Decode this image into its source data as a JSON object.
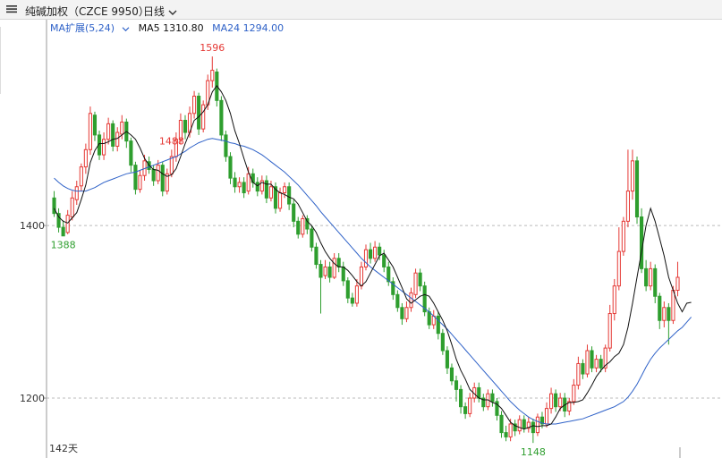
{
  "toolbar": {
    "menu_icon": "hamburger-icon",
    "symbol": "纯碱加权（CZCE 9950）",
    "period": "日线",
    "period_icon": "chevron-down-icon"
  },
  "ma_bar": {
    "ext_label": "MA扩展(5,24)",
    "ma5_label": "MA5 1310.80",
    "ma24_label": "MA24 1294.00",
    "ma5_color": "#111111",
    "ma24_color": "#2f62c8",
    "ext_color": "#2f62c8"
  },
  "colors": {
    "up": "#e53935",
    "down": "#2e9e2e",
    "grid": "#bbbbbb"
  },
  "chart_data": {
    "type": "candlestick",
    "days_label": "142天",
    "y_ticks": [
      1200,
      1400
    ],
    "ylim": [
      1143,
      1620
    ],
    "annotations": {
      "high": 1596,
      "high2": 1488,
      "low": 1148,
      "low_start": 1388
    },
    "ma5_latest": 1310.8,
    "ma24_latest": 1294.0,
    "candles": [
      [
        1432,
        1414,
        1440,
        1410
      ],
      [
        1414,
        1398,
        1420,
        1392
      ],
      [
        1398,
        1388,
        1406,
        1388
      ],
      [
        1392,
        1412,
        1418,
        1390
      ],
      [
        1410,
        1432,
        1440,
        1406
      ],
      [
        1430,
        1445,
        1452,
        1424
      ],
      [
        1446,
        1468,
        1472,
        1440
      ],
      [
        1468,
        1488,
        1495,
        1460
      ],
      [
        1488,
        1530,
        1538,
        1482
      ],
      [
        1528,
        1505,
        1532,
        1498
      ],
      [
        1505,
        1482,
        1510,
        1476
      ],
      [
        1482,
        1500,
        1508,
        1476
      ],
      [
        1500,
        1518,
        1525,
        1494
      ],
      [
        1518,
        1492,
        1522,
        1486
      ],
      [
        1492,
        1508,
        1514,
        1486
      ],
      [
        1506,
        1520,
        1528,
        1500
      ],
      [
        1520,
        1498,
        1524,
        1490
      ],
      [
        1498,
        1470,
        1502,
        1462
      ],
      [
        1470,
        1442,
        1474,
        1436
      ],
      [
        1442,
        1458,
        1464,
        1438
      ],
      [
        1458,
        1475,
        1482,
        1452
      ],
      [
        1474,
        1465,
        1480,
        1460
      ],
      [
        1465,
        1452,
        1470,
        1446
      ],
      [
        1452,
        1470,
        1476,
        1448
      ],
      [
        1470,
        1440,
        1474,
        1434
      ],
      [
        1440,
        1460,
        1466,
        1436
      ],
      [
        1460,
        1480,
        1488,
        1456
      ],
      [
        1480,
        1500,
        1508,
        1474
      ],
      [
        1500,
        1522,
        1530,
        1494
      ],
      [
        1522,
        1508,
        1528,
        1500
      ],
      [
        1508,
        1530,
        1538,
        1502
      ],
      [
        1530,
        1550,
        1556,
        1524
      ],
      [
        1550,
        1512,
        1554,
        1505
      ],
      [
        1512,
        1540,
        1545,
        1508
      ],
      [
        1540,
        1568,
        1575,
        1534
      ],
      [
        1568,
        1580,
        1596,
        1560
      ],
      [
        1578,
        1545,
        1582,
        1538
      ],
      [
        1545,
        1505,
        1550,
        1498
      ],
      [
        1505,
        1480,
        1510,
        1474
      ],
      [
        1480,
        1455,
        1485,
        1448
      ],
      [
        1455,
        1445,
        1462,
        1438
      ],
      [
        1445,
        1450,
        1456,
        1438
      ],
      [
        1450,
        1438,
        1456,
        1432
      ],
      [
        1440,
        1460,
        1468,
        1436
      ],
      [
        1460,
        1450,
        1466,
        1444
      ],
      [
        1450,
        1440,
        1456,
        1434
      ],
      [
        1440,
        1452,
        1458,
        1436
      ],
      [
        1452,
        1432,
        1458,
        1426
      ],
      [
        1432,
        1445,
        1452,
        1428
      ],
      [
        1445,
        1420,
        1450,
        1414
      ],
      [
        1420,
        1438,
        1444,
        1416
      ],
      [
        1438,
        1445,
        1450,
        1432
      ],
      [
        1445,
        1425,
        1450,
        1418
      ],
      [
        1425,
        1405,
        1430,
        1398
      ],
      [
        1405,
        1390,
        1410,
        1385
      ],
      [
        1390,
        1408,
        1412,
        1386
      ],
      [
        1408,
        1396,
        1412,
        1390
      ],
      [
        1396,
        1375,
        1400,
        1370
      ],
      [
        1375,
        1355,
        1380,
        1350
      ],
      [
        1355,
        1340,
        1360,
        1298
      ],
      [
        1342,
        1352,
        1360,
        1338
      ],
      [
        1352,
        1340,
        1358,
        1334
      ],
      [
        1340,
        1362,
        1368,
        1338
      ],
      [
        1362,
        1352,
        1368,
        1346
      ],
      [
        1352,
        1336,
        1358,
        1330
      ],
      [
        1336,
        1316,
        1340,
        1310
      ],
      [
        1316,
        1310,
        1322,
        1306
      ],
      [
        1310,
        1330,
        1338,
        1306
      ],
      [
        1330,
        1352,
        1358,
        1326
      ],
      [
        1352,
        1372,
        1378,
        1348
      ],
      [
        1372,
        1362,
        1380,
        1356
      ],
      [
        1362,
        1375,
        1382,
        1358
      ],
      [
        1375,
        1366,
        1380,
        1360
      ],
      [
        1366,
        1352,
        1372,
        1346
      ],
      [
        1352,
        1335,
        1358,
        1330
      ],
      [
        1335,
        1320,
        1340,
        1314
      ],
      [
        1320,
        1305,
        1325,
        1300
      ],
      [
        1305,
        1292,
        1310,
        1285
      ],
      [
        1292,
        1305,
        1312,
        1288
      ],
      [
        1305,
        1322,
        1328,
        1300
      ],
      [
        1320,
        1345,
        1350,
        1316
      ],
      [
        1345,
        1330,
        1350,
        1324
      ],
      [
        1330,
        1300,
        1335,
        1295
      ],
      [
        1300,
        1285,
        1305,
        1280
      ],
      [
        1285,
        1295,
        1302,
        1280
      ],
      [
        1295,
        1275,
        1300,
        1268
      ],
      [
        1275,
        1255,
        1280,
        1250
      ],
      [
        1255,
        1235,
        1260,
        1228
      ],
      [
        1235,
        1220,
        1240,
        1215
      ],
      [
        1220,
        1210,
        1226,
        1196
      ],
      [
        1210,
        1190,
        1215,
        1182
      ],
      [
        1190,
        1182,
        1195,
        1176
      ],
      [
        1182,
        1200,
        1206,
        1178
      ],
      [
        1200,
        1212,
        1218,
        1195
      ],
      [
        1212,
        1200,
        1218,
        1195
      ],
      [
        1200,
        1190,
        1205,
        1185
      ],
      [
        1190,
        1205,
        1210,
        1186
      ],
      [
        1205,
        1196,
        1210,
        1190
      ],
      [
        1196,
        1180,
        1200,
        1174
      ],
      [
        1180,
        1160,
        1185,
        1154
      ],
      [
        1160,
        1155,
        1168,
        1150
      ],
      [
        1155,
        1170,
        1176,
        1150
      ],
      [
        1170,
        1162,
        1175,
        1156
      ],
      [
        1162,
        1175,
        1180,
        1158
      ],
      [
        1175,
        1165,
        1180,
        1160
      ],
      [
        1165,
        1172,
        1178,
        1160
      ],
      [
        1172,
        1160,
        1176,
        1148
      ],
      [
        1160,
        1178,
        1182,
        1156
      ],
      [
        1178,
        1170,
        1184,
        1165
      ],
      [
        1170,
        1188,
        1195,
        1166
      ],
      [
        1188,
        1205,
        1212,
        1182
      ],
      [
        1205,
        1190,
        1210,
        1184
      ],
      [
        1190,
        1200,
        1206,
        1185
      ],
      [
        1200,
        1185,
        1206,
        1178
      ],
      [
        1185,
        1196,
        1200,
        1180
      ],
      [
        1196,
        1215,
        1222,
        1192
      ],
      [
        1215,
        1240,
        1248,
        1210
      ],
      [
        1240,
        1228,
        1245,
        1222
      ],
      [
        1228,
        1255,
        1262,
        1224
      ],
      [
        1255,
        1235,
        1260,
        1230
      ],
      [
        1235,
        1245,
        1250,
        1230
      ],
      [
        1245,
        1235,
        1250,
        1230
      ],
      [
        1235,
        1258,
        1262,
        1230
      ],
      [
        1258,
        1298,
        1308,
        1254
      ],
      [
        1298,
        1330,
        1338,
        1290
      ],
      [
        1330,
        1370,
        1398,
        1325
      ],
      [
        1370,
        1405,
        1410,
        1365
      ],
      [
        1405,
        1440,
        1488,
        1398
      ],
      [
        1440,
        1475,
        1488,
        1430
      ],
      [
        1475,
        1410,
        1480,
        1402
      ],
      [
        1410,
        1350,
        1420,
        1345
      ],
      [
        1350,
        1330,
        1360,
        1324
      ],
      [
        1330,
        1350,
        1358,
        1325
      ],
      [
        1350,
        1318,
        1355,
        1310
      ],
      [
        1318,
        1290,
        1322,
        1280
      ],
      [
        1290,
        1305,
        1312,
        1282
      ],
      [
        1305,
        1290,
        1310,
        1262
      ],
      [
        1290,
        1325,
        1330,
        1286
      ],
      [
        1325,
        1340,
        1358,
        1318
      ]
    ],
    "ma5": [
      1420,
      1410,
      1405,
      1403,
      1409,
      1415,
      1430,
      1447,
      1473,
      1487,
      1495,
      1495,
      1497,
      1500,
      1501,
      1505,
      1509,
      1505,
      1500,
      1490,
      1478,
      1470,
      1465,
      1464,
      1460,
      1457,
      1459,
      1466,
      1480,
      1495,
      1508,
      1522,
      1526,
      1532,
      1540,
      1555,
      1562,
      1555,
      1545,
      1530,
      1510,
      1495,
      1478,
      1462,
      1450,
      1446,
      1450,
      1448,
      1448,
      1442,
      1438,
      1436,
      1433,
      1431,
      1425,
      1415,
      1405,
      1400,
      1392,
      1380,
      1370,
      1362,
      1356,
      1352,
      1352,
      1348,
      1342,
      1335,
      1330,
      1335,
      1345,
      1355,
      1365,
      1368,
      1360,
      1352,
      1340,
      1328,
      1315,
      1310,
      1314,
      1318,
      1320,
      1318,
      1310,
      1300,
      1290,
      1278,
      1262,
      1245,
      1232,
      1222,
      1210,
      1205,
      1200,
      1198,
      1198,
      1195,
      1193,
      1188,
      1180,
      1172,
      1168,
      1166,
      1164,
      1166,
      1168,
      1167,
      1168,
      1168,
      1170,
      1178,
      1188,
      1192,
      1195,
      1195,
      1196,
      1198,
      1206,
      1215,
      1225,
      1232,
      1238,
      1242,
      1248,
      1252,
      1262,
      1282,
      1310,
      1340,
      1370,
      1400,
      1420,
      1405,
      1385,
      1365,
      1340,
      1325,
      1310,
      1300,
      1310,
      1311
    ],
    "ma24": [
      1455,
      1450,
      1446,
      1443,
      1441,
      1440,
      1440,
      1440,
      1442,
      1444,
      1447,
      1450,
      1452,
      1454,
      1456,
      1458,
      1460,
      1461,
      1462,
      1464,
      1466,
      1468,
      1470,
      1472,
      1474,
      1476,
      1478,
      1480,
      1483,
      1486,
      1490,
      1493,
      1496,
      1498,
      1500,
      1501,
      1500,
      1499,
      1498,
      1496,
      1495,
      1493,
      1492,
      1490,
      1488,
      1485,
      1482,
      1478,
      1474,
      1470,
      1466,
      1462,
      1457,
      1452,
      1447,
      1441,
      1435,
      1429,
      1423,
      1416,
      1410,
      1404,
      1398,
      1392,
      1386,
      1380,
      1374,
      1368,
      1362,
      1357,
      1352,
      1348,
      1344,
      1340,
      1336,
      1332,
      1328,
      1324,
      1320,
      1316,
      1312,
      1308,
      1304,
      1300,
      1295,
      1290,
      1285,
      1280,
      1274,
      1268,
      1262,
      1256,
      1250,
      1244,
      1238,
      1232,
      1226,
      1220,
      1214,
      1208,
      1202,
      1196,
      1191,
      1186,
      1182,
      1178,
      1175,
      1173,
      1171,
      1170,
      1170,
      1170,
      1171,
      1172,
      1173,
      1174,
      1175,
      1176,
      1178,
      1180,
      1182,
      1184,
      1186,
      1188,
      1190,
      1193,
      1196,
      1201,
      1208,
      1216,
      1226,
      1236,
      1245,
      1252,
      1258,
      1263,
      1268,
      1273,
      1278,
      1282,
      1288,
      1294
    ]
  }
}
